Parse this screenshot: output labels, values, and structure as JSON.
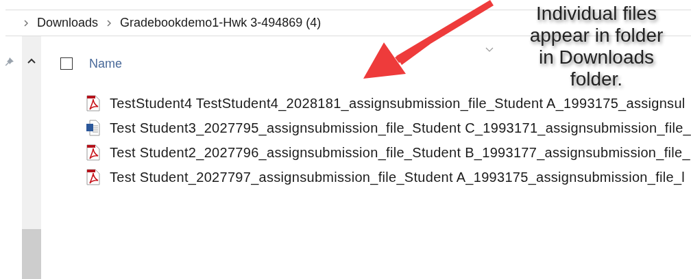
{
  "breadcrumb": [
    {
      "label": "Downloads"
    },
    {
      "label": "Gradebookdemo1-Hwk 3-494869 (4)"
    }
  ],
  "header": {
    "checked": false,
    "column": "Name"
  },
  "files": [
    {
      "kind": "pdf",
      "name": "TestStudent4 TestStudent4_2028181_assignsubmission_file_Student A_1993175_assignsul"
    },
    {
      "kind": "word",
      "name": "Test Student3_2027795_assignsubmission_file_Student C_1993171_assignsubmission_file_"
    },
    {
      "kind": "pdf",
      "name": "Test Student2_2027796_assignsubmission_file_Student B_1993177_assignsubmission_file_"
    },
    {
      "kind": "pdf",
      "name": "Test Student_2027797_assignsubmission_file_Student A_1993175_assignsubmission_file_l"
    }
  ],
  "annotation": {
    "lines": [
      "Individual files",
      "appear in folder",
      "in Downloads",
      "folder."
    ]
  }
}
